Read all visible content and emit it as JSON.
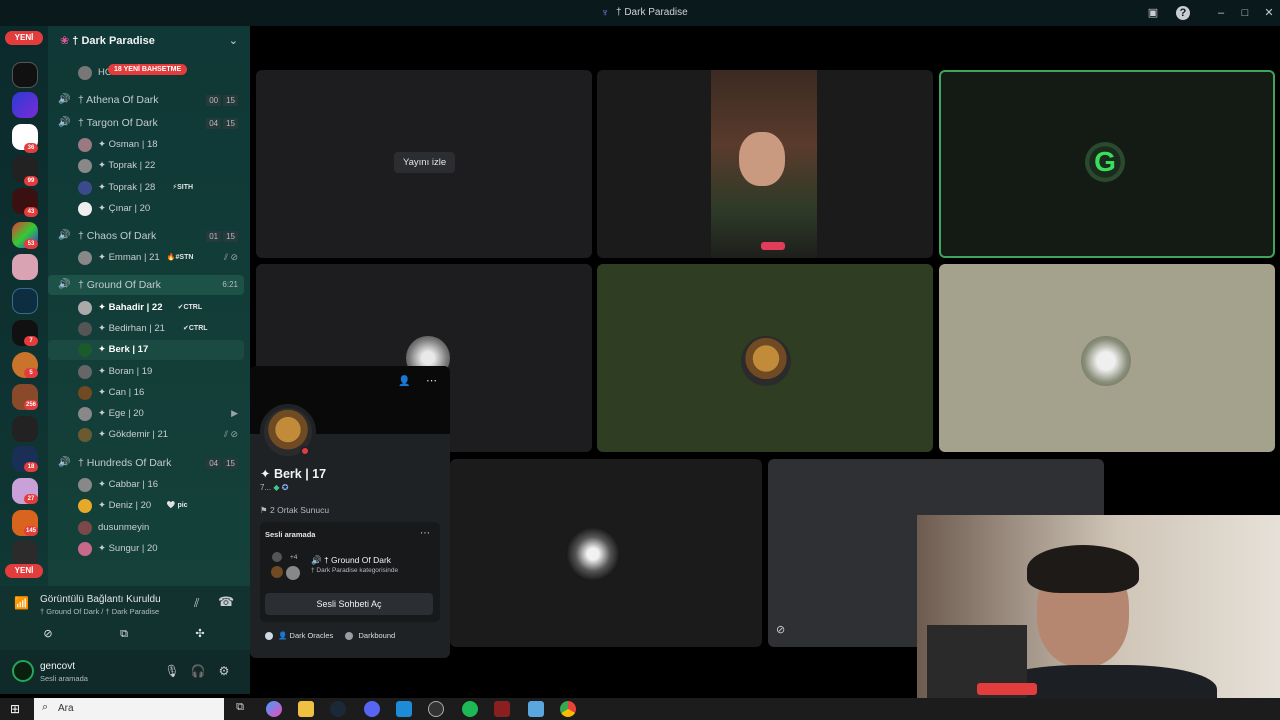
{
  "window": {
    "title": "† Dark Paradise"
  },
  "rail": {
    "new_label_top": "YENİ",
    "new_label_bottom": "YENİ",
    "badges": [
      "36",
      "99",
      "43",
      "53",
      "7",
      "5",
      "256",
      "18",
      "27",
      "145"
    ]
  },
  "server": {
    "name": "† Dark Paradise",
    "new_messages_pill": "18 YENİ BAHSETME"
  },
  "channels": [
    {
      "type": "user",
      "name": "HONGKONG"
    },
    {
      "type": "voice",
      "name": "† Athena Of Dark",
      "count_a": "00",
      "count_b": "15"
    },
    {
      "type": "voice",
      "name": "† Targon Of Dark",
      "count_a": "04",
      "count_b": "15"
    },
    {
      "type": "user",
      "name": "✦ Osman | 18"
    },
    {
      "type": "user",
      "name": "✦ Toprak | 22"
    },
    {
      "type": "user",
      "name": "✦ Toprak | 28",
      "tag": "⚡SITH"
    },
    {
      "type": "user",
      "name": "✦ Çınar | 20"
    },
    {
      "type": "voice",
      "name": "† Chaos Of Dark",
      "count_a": "01",
      "count_b": "15"
    },
    {
      "type": "user",
      "name": "✦ Emman | 21",
      "tag": "🔥#STN"
    },
    {
      "type": "voice",
      "name": "† Ground Of Dark",
      "timer": "6:21"
    },
    {
      "type": "user",
      "name": "✦ Bahadir | 22",
      "tag": "✔CTRL"
    },
    {
      "type": "user",
      "name": "✦ Bedirhan | 21",
      "tag": "✔CTRL"
    },
    {
      "type": "user",
      "name": "✦ Berk | 17"
    },
    {
      "type": "user",
      "name": "✦ Boran | 19"
    },
    {
      "type": "user",
      "name": "✦ Can | 16"
    },
    {
      "type": "user",
      "name": "✦ Ege | 20"
    },
    {
      "type": "user",
      "name": "✦ Gökdemir | 21"
    },
    {
      "type": "voice",
      "name": "† Hundreds Of Dark",
      "count_a": "04",
      "count_b": "15"
    },
    {
      "type": "user",
      "name": "✦ Cabbar | 16"
    },
    {
      "type": "user",
      "name": "✦ Deniz | 20",
      "tag": "🤍 pic"
    },
    {
      "type": "user",
      "name": "dusunmeyin"
    },
    {
      "type": "user",
      "name": "✦ Sungur | 20"
    }
  ],
  "voice_panel": {
    "status": "Görüntülü Bağlantı Kuruldu",
    "location": "† Ground Of Dark / † Dark Paradise"
  },
  "user_panel": {
    "name": "gencovt",
    "status": "Sesli aramada"
  },
  "stage": {
    "watch_stream": "Yayını izle"
  },
  "profile": {
    "name": "✦ Berk | 17",
    "short": "7...",
    "mutual": "2 Ortak Sunucu",
    "section": "Sesli aramada",
    "channel": "† Ground Of Dark",
    "channel_sub": "† Dark Paradise kategorisinde",
    "extra_count": "+4",
    "open_button": "Sesli Sohbeti Aç",
    "roles": [
      "Dark Oracles",
      "Darkbound"
    ]
  },
  "taskbar": {
    "search_placeholder": "Ara"
  }
}
